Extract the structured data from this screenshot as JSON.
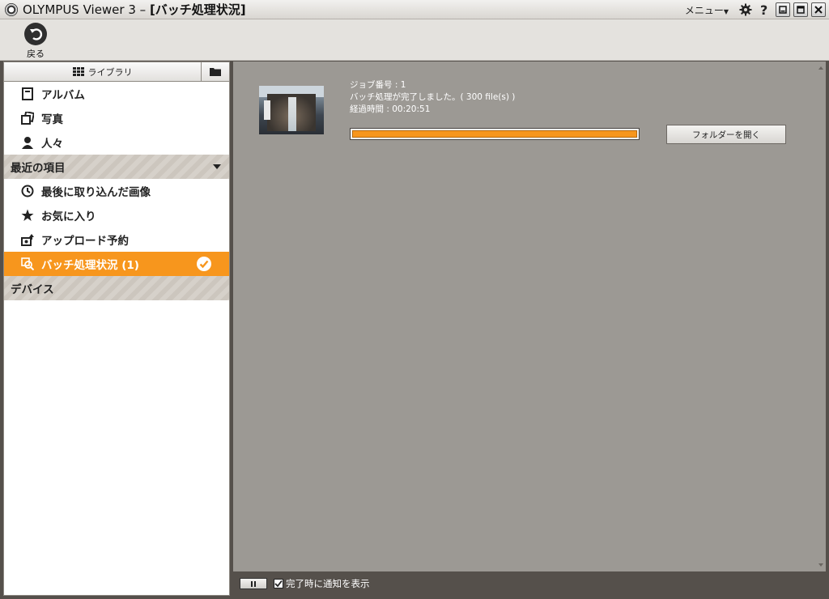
{
  "window": {
    "app_title": "OLYMPUS Viewer 3 – ",
    "doc_title": "[バッチ処理状況]",
    "menu_label": "メニュー",
    "menu_caret": "▼"
  },
  "toolbar": {
    "back_label": "戻る"
  },
  "sidebar": {
    "tab_library": "ライブラリ",
    "library_items": [
      {
        "label": "アルバム",
        "icon": "album-icon"
      },
      {
        "label": "写真",
        "icon": "photos-icon"
      },
      {
        "label": "人々",
        "icon": "person-icon"
      }
    ],
    "recent_section": "最近の項目",
    "recent_items": [
      {
        "label": "最後に取り込んだ画像",
        "icon": "recent-import-icon"
      },
      {
        "label": "お気に入り",
        "icon": "star-icon"
      },
      {
        "label": "アップロード予約",
        "icon": "upload-icon"
      },
      {
        "label": "バッチ処理状況 (1)",
        "icon": "batch-process-icon",
        "active": true
      }
    ],
    "device_section": "デバイス",
    "accent_color": "#f7961d"
  },
  "job": {
    "number_line": "ジョブ番号 : 1",
    "status_line": "バッチ処理が完了しました。( 300 file(s) )",
    "elapsed_line": "経過時間 : 00:20:51",
    "progress_fraction": 1.0,
    "open_folder_label": "フォルダーを開く"
  },
  "bottom": {
    "notify_label": "完了時に通知を表示",
    "notify_checked": true
  }
}
